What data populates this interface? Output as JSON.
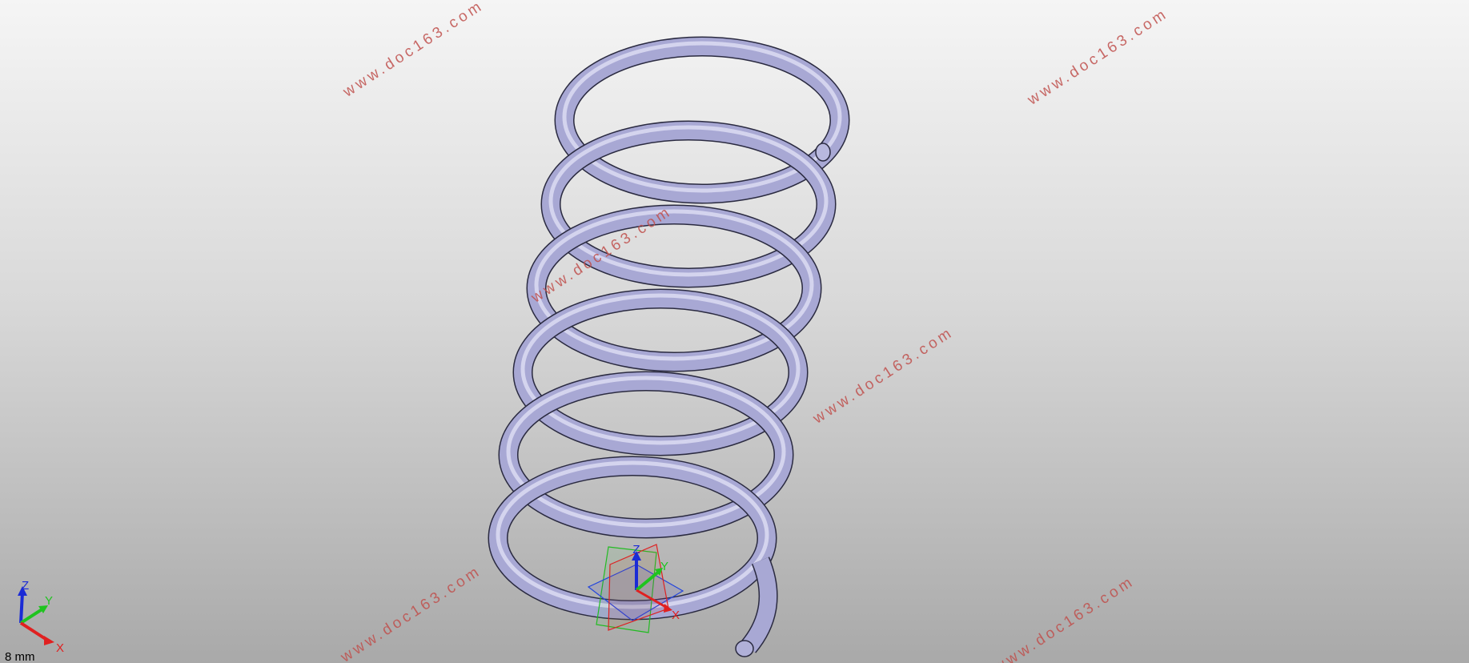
{
  "viewport": {
    "background_top": "#f5f5f5",
    "background_bottom": "#a9a9a9",
    "model": "helical-spring",
    "spring_color": "#a8a8d4",
    "spring_edge_color": "#2a2a40"
  },
  "watermarks": [
    "www.doc163.com",
    "www.doc163.com",
    "www.doc163.com",
    "www.doc163.com",
    "www.doc163.com",
    "www.doc163.com"
  ],
  "triad": {
    "x_label": "X",
    "y_label": "Y",
    "z_label": "Z"
  },
  "origin_triad": {
    "x_label": "X",
    "y_label": "Y",
    "z_label": "Z"
  },
  "scale_bar": {
    "text": "8 mm"
  }
}
